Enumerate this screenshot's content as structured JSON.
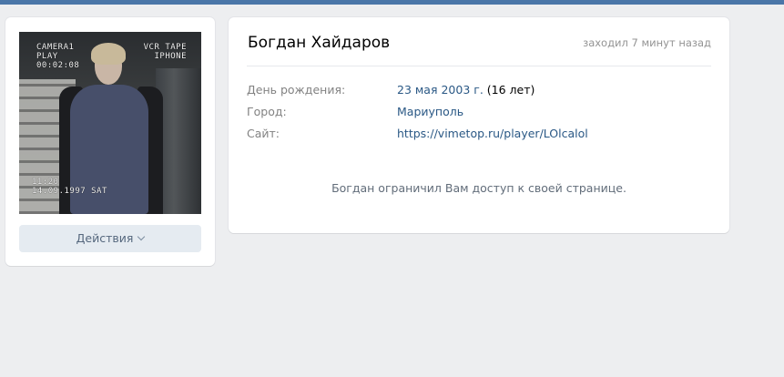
{
  "profile": {
    "name": "Богдан Хайдаров",
    "last_seen": "заходил 7 минут назад",
    "photo_overlay": {
      "top_left": [
        "CAMERA1",
        "PLAY",
        "00:02:08"
      ],
      "top_right": [
        "VCR TAPE",
        "IPHONE"
      ],
      "bottom_left": [
        "11:20",
        "14.09.1997 SAT"
      ]
    },
    "actions_label": "Действия",
    "info": [
      {
        "label": "День рождения:",
        "value": "23 мая 2003 г.",
        "extra": " (16 лет)"
      },
      {
        "label": "Город:",
        "value": "Мариуполь",
        "extra": ""
      },
      {
        "label": "Сайт:",
        "value": "https://vimetop.ru/player/LOlcalol",
        "extra": ""
      }
    ],
    "restricted_message": "Богдан ограничил Вам доступ к своей странице."
  },
  "colors": {
    "topbar": "#4a76a8",
    "background": "#edeef0",
    "link": "#2a5885",
    "button_bg": "#e5ebf1"
  },
  "icons": {
    "actions_dropdown": "chevron-down-icon"
  }
}
